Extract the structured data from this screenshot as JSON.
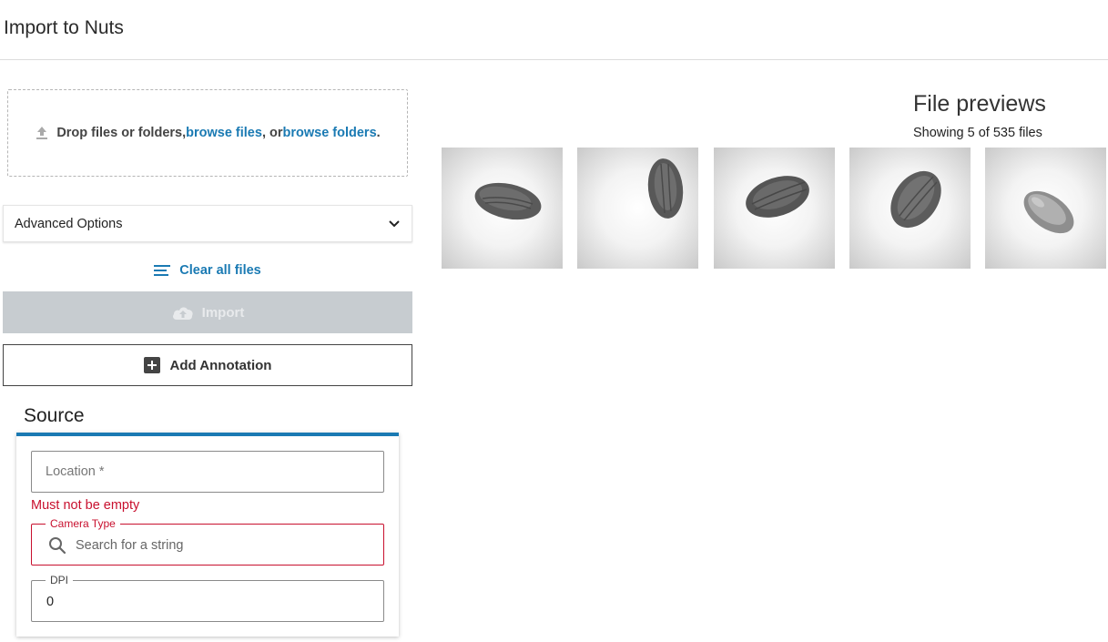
{
  "header": {
    "title": "Import to Nuts"
  },
  "dropzone": {
    "prefix": "Drop files or folders, ",
    "browse_files": "browse files",
    "middle": ", or ",
    "browse_folders": "browse folders",
    "suffix": "."
  },
  "advanced_options": {
    "label": "Advanced Options"
  },
  "clear_all": {
    "label": "Clear all files"
  },
  "import_button": {
    "label": "Import",
    "enabled": false
  },
  "add_annotation": {
    "label": "Add Annotation"
  },
  "source": {
    "title": "Source",
    "location": {
      "placeholder": "Location *",
      "error": "Must not be empty"
    },
    "camera_type": {
      "label": "Camera Type",
      "placeholder": "Search for a string"
    },
    "dpi": {
      "label": "DPI",
      "value": "0"
    }
  },
  "previews": {
    "title": "File previews",
    "count_text": "Showing 5 of 535 files"
  },
  "colors": {
    "accent": "#1a7ab3",
    "error": "#c8102e",
    "disabled": "#c7ccd0"
  }
}
